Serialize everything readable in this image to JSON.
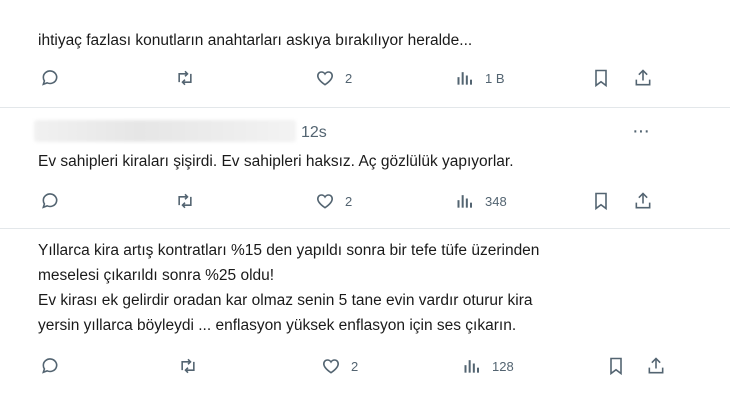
{
  "tweets": [
    {
      "lines": [
        "ihtiyaç fazlası konutların anahtarları askıya bırakılıyor heralde..."
      ],
      "actions": {
        "replies": "",
        "retweets": "",
        "likes": "2",
        "views": "1 B"
      }
    },
    {
      "time": "12s",
      "more": "···",
      "lines": [
        "Ev sahipleri kiraları şişirdi. Ev sahipleri haksız. Aç gözlülük yapıyorlar."
      ],
      "actions": {
        "replies": "",
        "retweets": "",
        "likes": "2",
        "views": "348"
      }
    },
    {
      "lines": [
        "Yıllarca kira  artış kontratları %15 den yapıldı sonra bir tefe tüfe üzerinden",
        "meselesi çıkarıldı sonra %25 oldu!",
        "Ev kirası ek gelirdir oradan kar olmaz senin 5 tane evin vardır oturur kira",
        "yersin yıllarca böyleydi ... enflasyon yüksek enflasyon için ses çıkarın."
      ],
      "actions": {
        "replies": "",
        "retweets": "",
        "likes": "2",
        "views": "128"
      }
    }
  ]
}
